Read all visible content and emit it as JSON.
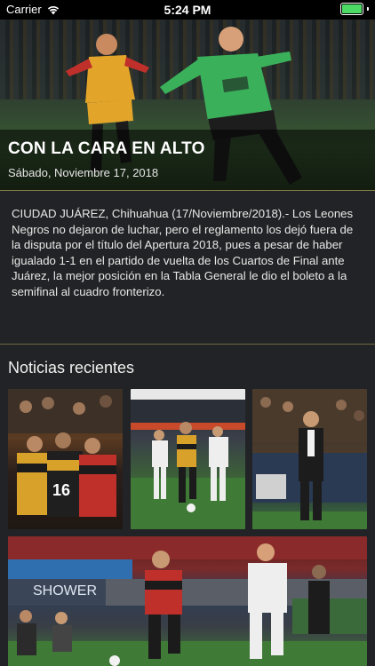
{
  "status_bar": {
    "carrier": "Carrier",
    "time": "5:24 PM"
  },
  "hero": {
    "title": "CON LA CARA EN ALTO",
    "date": "Sábado, Noviembre 17, 2018"
  },
  "article": {
    "body": "CIUDAD JUÁREZ, Chihuahua (17/Noviembre/2018).- Los Leones Negros no dejaron de luchar, pero el reglamento los dejó fuera de la disputa por el título del Apertura 2018, pues a pesar de haber igualado 1-1 en el partido de vuelta de los Cuartos de Final ante Juárez, la mejor posición en la Tabla General le dio el boleto a la semifinal al cuadro fronterizo."
  },
  "recent_news": {
    "title": "Noticias recientes",
    "items": [
      {
        "icon": "team-huddle-photo"
      },
      {
        "icon": "match-action-photo"
      },
      {
        "icon": "coach-photo"
      },
      {
        "icon": "player-dribbling-photo"
      }
    ]
  },
  "colors": {
    "background": "#222326",
    "accent_line": "#7d7a42",
    "battery": "#4cd964"
  }
}
